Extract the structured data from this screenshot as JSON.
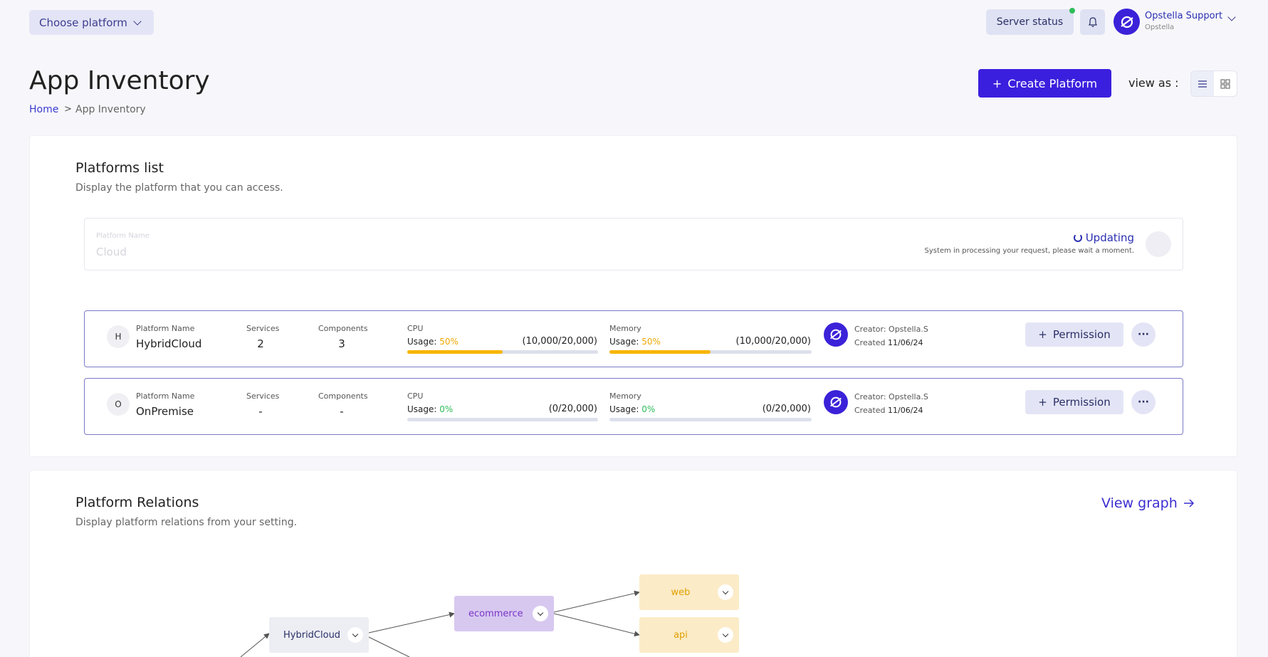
{
  "topbar": {
    "choose_platform": "Choose platform",
    "server_status": "Server status",
    "user_name": "Opstella Support",
    "user_org": "Opstella"
  },
  "header": {
    "title": "App Inventory",
    "breadcrumb": {
      "home": "Home",
      "separator": ">",
      "current": "App Inventory"
    },
    "create_button": "Create Platform",
    "create_icon": "+",
    "view_as": "view as :"
  },
  "platforms": {
    "title": "Platforms list",
    "subtitle": "Display the platform that you can access.",
    "updating": {
      "label": "Platform Name",
      "value": "Cloud",
      "status": "Updating",
      "note": "System in processing your request, please wait a moment."
    },
    "columns": {
      "name": "Platform Name",
      "services": "Services",
      "components": "Components",
      "cpu": "CPU",
      "memory": "Memory",
      "usage": "Usage:"
    },
    "rows": [
      {
        "initial": "H",
        "name": "HybridCloud",
        "services": "2",
        "components": "3",
        "cpu_pct": "50%",
        "cpu_fraction": 0.5,
        "cpu_ratio": "(10,000/20,000)",
        "mem_pct": "50%",
        "mem_fraction": 0.5,
        "mem_ratio": "(10,000/20,000)",
        "creator": "Creator: Opstella.S",
        "created_label": "Created",
        "created_date": "11/06/24",
        "permission": "Permission"
      },
      {
        "initial": "O",
        "name": "OnPremise",
        "services": "-",
        "components": "-",
        "cpu_pct": "0%",
        "cpu_fraction": 0,
        "cpu_ratio": "(0/20,000)",
        "mem_pct": "0%",
        "mem_fraction": 0,
        "mem_ratio": "(0/20,000)",
        "creator": "Creator: Opstella.S",
        "created_label": "Created",
        "created_date": "11/06/24",
        "permission": "Permission"
      }
    ]
  },
  "relations": {
    "title": "Platform Relations",
    "subtitle": "Display platform relations from your setting.",
    "view_graph": "View graph",
    "nodes": {
      "hybrid": "HybridCloud",
      "ecommerce": "ecommerce",
      "web": "web",
      "api": "api"
    }
  },
  "colors": {
    "accent": "#3b1fde",
    "usage_warn": "#f0a800",
    "usage_ok": "#2ebd59"
  }
}
